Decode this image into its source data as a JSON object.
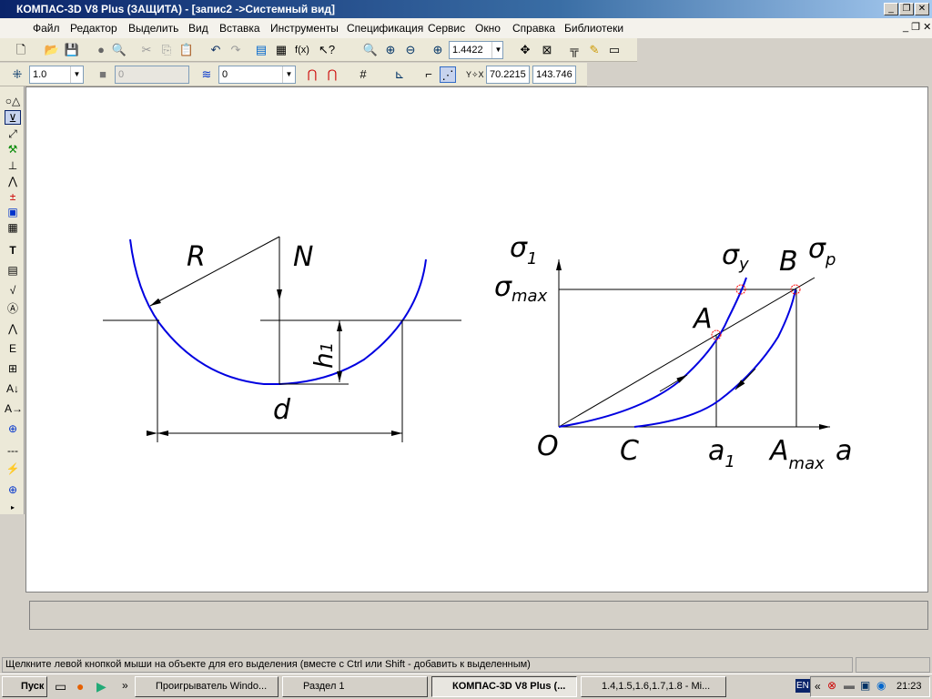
{
  "window": {
    "title": "КОМПАС-3D V8 Plus (ЗАЩИТА) - [запис2 ->Системный вид]",
    "min": "_",
    "max": "❐",
    "close": "✕"
  },
  "menu": [
    "Файл",
    "Редактор",
    "Выделить",
    "Вид",
    "Вставка",
    "Инструменты",
    "Спецификация",
    "Сервис",
    "Окно",
    "Справка",
    "Библиотеки"
  ],
  "toolbar": {
    "zoom_value": "1.4422",
    "line_step": "1.0",
    "style_value": "0",
    "layer_value": "0",
    "coord_x": "70.2215",
    "coord_y": "143.746"
  },
  "drawing": {
    "left": {
      "R": "R",
      "N": "N",
      "h": "h",
      "h_sub": "1",
      "d": "d"
    },
    "right": {
      "sigma1": "σ",
      "sigma1_sub": "1",
      "sigmamax": "σ",
      "sigmamax_sub": "max",
      "sigmay": "σ",
      "sigmay_sub": "y",
      "B": "B",
      "sigmap": "σ",
      "sigmap_sub": "p",
      "A": "A",
      "O": "O",
      "C": "C",
      "a1": "a",
      "a1_sub": "1",
      "Amax": "A",
      "Amax_sub": "max",
      "a": "a"
    }
  },
  "status": {
    "text": "Щелкните левой кнопкой мыши на объекте для его выделения (вместе с Ctrl или Shift - добавить к выделенным)"
  },
  "taskbar": {
    "start": "Пуск",
    "tasks": [
      "Проигрыватель Windo...",
      "Раздел 1",
      "КОМПАС-3D V8 Plus (...",
      "1.4,1.5,1.6,1.7,1.8 - Mi..."
    ],
    "lang": "EN",
    "clock": "21:23"
  }
}
